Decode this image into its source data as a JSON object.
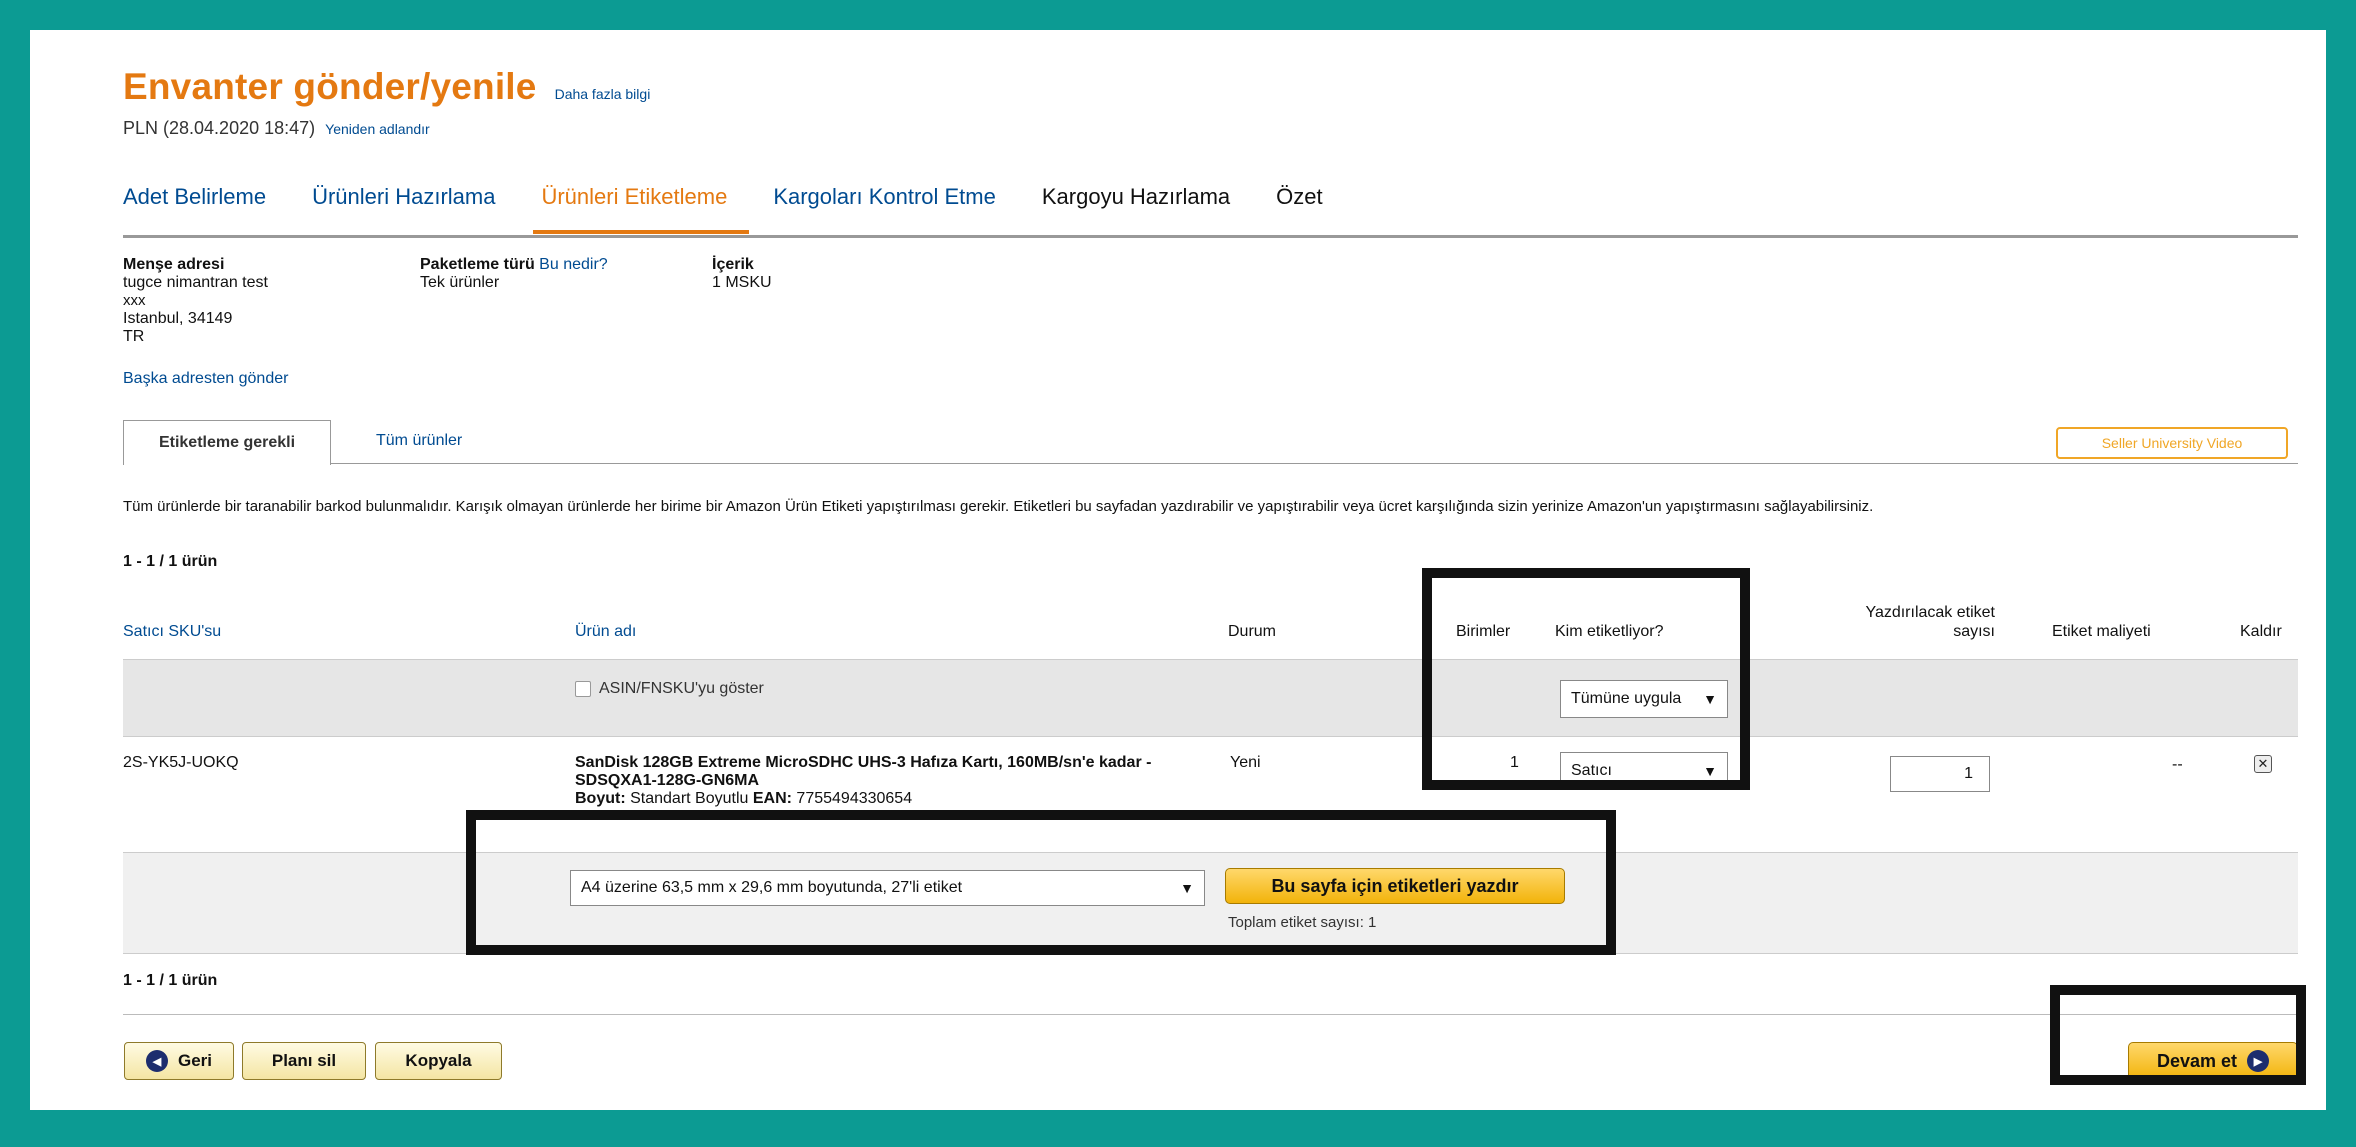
{
  "header": {
    "title": "Envanter gönder/yenile",
    "more_info": "Daha fazla bilgi",
    "plan_name": "PLN (28.04.2020 18:47)",
    "rename": "Yeniden adlandır"
  },
  "steps": [
    {
      "label": "Adet Belirleme",
      "state": "done"
    },
    {
      "label": "Ürünleri Hazırlama",
      "state": "done"
    },
    {
      "label": "Ürünleri Etiketleme",
      "state": "active"
    },
    {
      "label": "Kargoları Kontrol Etme",
      "state": "done"
    },
    {
      "label": "Kargoyu Hazırlama",
      "state": "todo"
    },
    {
      "label": "Özet",
      "state": "todo"
    }
  ],
  "origin": {
    "label": "Menşe adresi",
    "name": "tugce nimantran test",
    "line2": "xxx",
    "city": "Istanbul, 34149",
    "country": "TR",
    "other_address": "Başka adresten gönder"
  },
  "packing": {
    "label": "Paketleme türü",
    "help_link": "Bu nedir?",
    "value": "Tek ürünler"
  },
  "contents": {
    "label": "İçerik",
    "value": "1 MSKU"
  },
  "tabs": {
    "label_required": "Etiketleme gerekli",
    "all_products": "Tüm ürünler",
    "video": "Seller University Video"
  },
  "description": "Tüm ürünlerde bir taranabilir barkod bulunmalıdır. Karışık olmayan ürünlerde her birime bir Amazon Ürün Etiketi yapıştırılması gerekir. Etiketleri bu sayfadan yazdırabilir ve yapıştırabilir veya ücret karşılığında sizin yerinize Amazon'un yapıştırmasını sağlayabilirsiniz.",
  "count_label": "1 - 1 / 1 ürün",
  "table": {
    "headers": {
      "sku": "Satıcı SKU'su",
      "product": "Ürün adı",
      "condition": "Durum",
      "units": "Birimler",
      "who_labels": "Kim etiketliyor?",
      "label_count_1": "Yazdırılacak etiket",
      "label_count_2": "sayısı",
      "label_cost": "Etiket maliyeti",
      "remove": "Kaldır"
    },
    "filter_row": {
      "show_asin": "ASIN/FNSKU'yu göster",
      "apply_all": "Tümüne uygula"
    },
    "row": {
      "sku": "2S-YK5J-UOKQ",
      "product_title": "SanDisk 128GB Extreme MicroSDHC UHS-3 Hafıza Kartı, 160MB/sn'e kadar - SDSQXA1-128G-GN6MA",
      "size_label": "Boyut:",
      "size_value": "Standart Boyutlu",
      "ean_label": "EAN:",
      "ean_value": "7755494330654",
      "condition": "Yeni",
      "units": "1",
      "who_labels": "Satıcı",
      "label_count": "1",
      "label_cost": "--"
    }
  },
  "print_bar": {
    "format": "A4 üzerine 63,5 mm x 29,6 mm boyutunda, 27'li etiket",
    "print_button": "Bu sayfa için etiketleri yazdır",
    "total_labels": "Toplam etiket sayısı: 1"
  },
  "footer": {
    "back": "Geri",
    "delete_plan": "Planı sil",
    "copy": "Kopyala",
    "continue": "Devam et"
  },
  "colors": {
    "frame": "#0c9b93",
    "accent_orange": "#e47911",
    "link_blue": "#004b91",
    "button_gold": "#f2b30a"
  }
}
